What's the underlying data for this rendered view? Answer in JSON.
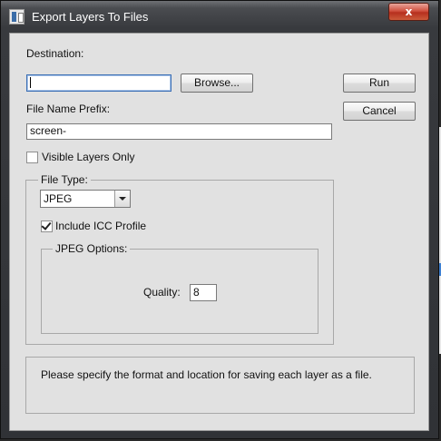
{
  "window": {
    "title": "Export Layers To Files",
    "close_glyph": "x"
  },
  "destination": {
    "label": "Destination:",
    "value": "",
    "browse_label": "Browse..."
  },
  "actions": {
    "run_label": "Run",
    "cancel_label": "Cancel"
  },
  "prefix": {
    "label": "File Name Prefix:",
    "value": "screen-"
  },
  "visible_only": {
    "label": "Visible Layers Only",
    "checked": false
  },
  "file_type": {
    "group_label": "File Type:",
    "selected": "JPEG",
    "include_icc_label": "Include ICC Profile",
    "include_icc_checked": true
  },
  "jpeg_options": {
    "group_label": "JPEG Options:",
    "quality_label": "Quality:",
    "quality_value": "8"
  },
  "status": {
    "message": "Please specify the format and location for saving each layer as a file."
  },
  "colors": {
    "dialog_bg": "#e1e1e1",
    "titlebar": "#383a3e",
    "close_button": "#c9412c",
    "focus_border": "#3c6fb4"
  }
}
